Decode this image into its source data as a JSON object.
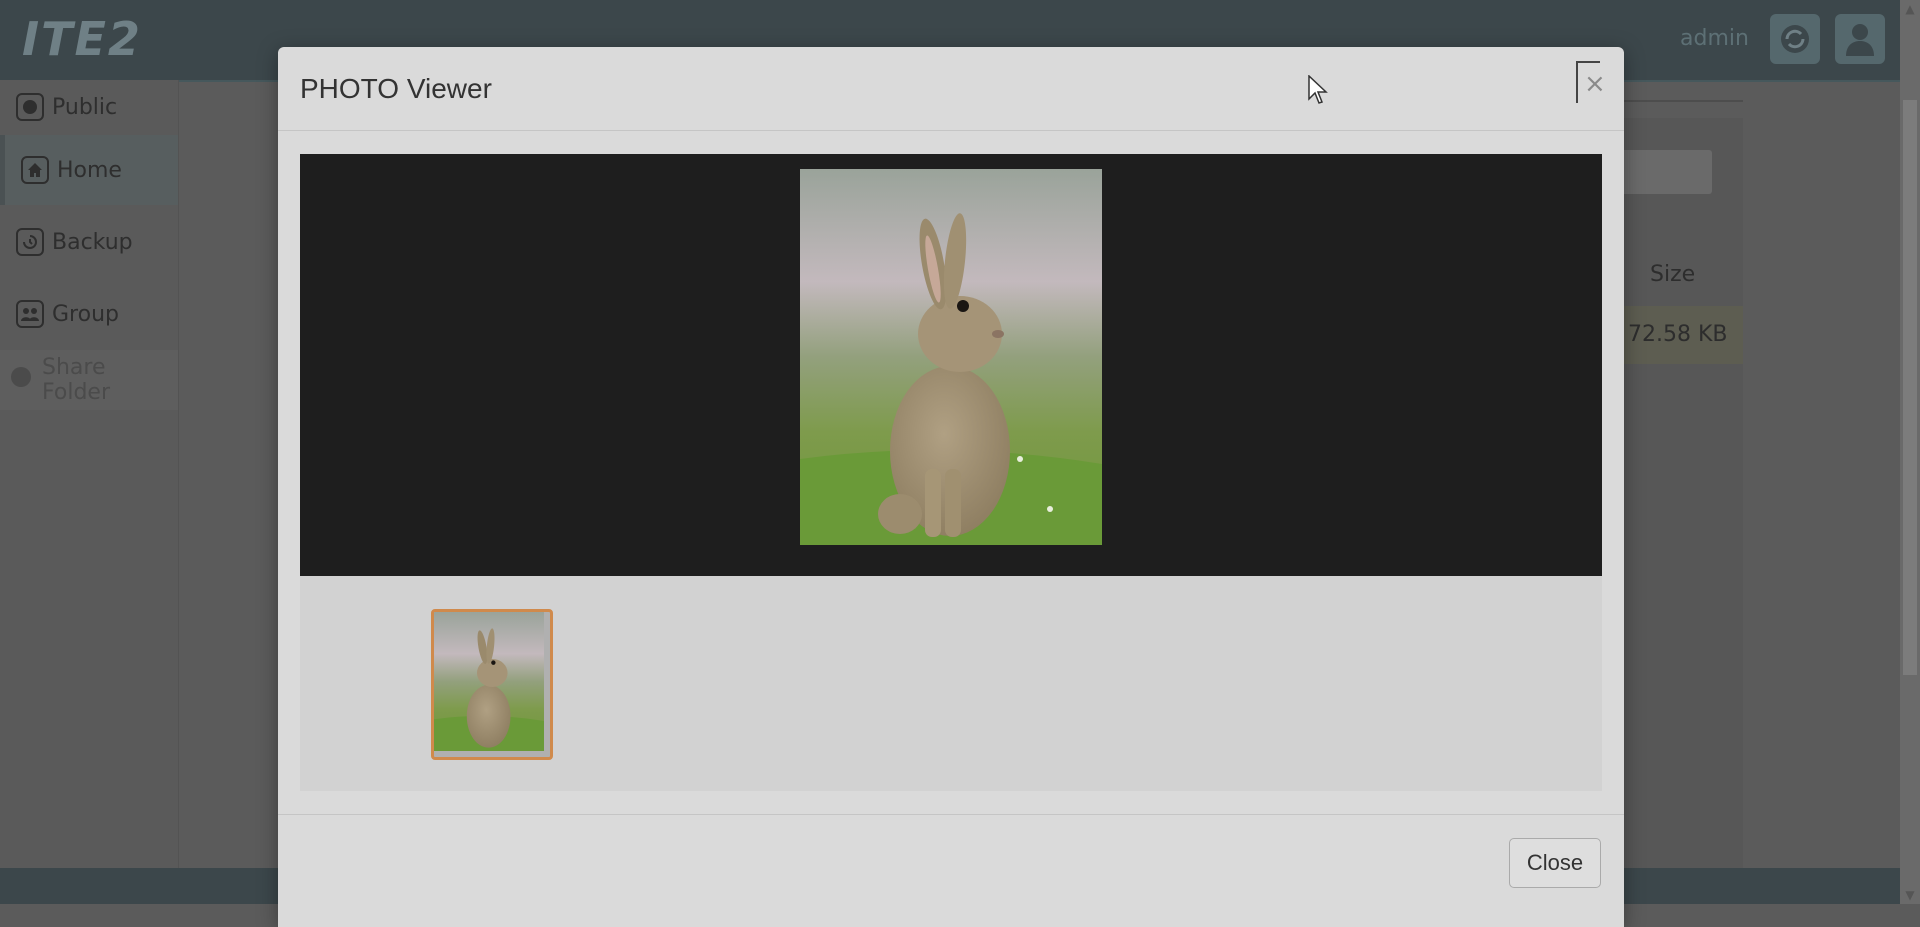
{
  "app": {
    "logo_text": "ITE2",
    "user_label": "admin"
  },
  "sidebar": {
    "items": [
      {
        "label": "Public",
        "icon": "globe-icon"
      },
      {
        "label": "Home",
        "icon": "home-icon"
      },
      {
        "label": "Backup",
        "icon": "backup-icon"
      },
      {
        "label": "Group",
        "icon": "group-icon"
      },
      {
        "label": "Share Folder",
        "icon": "share-icon"
      }
    ]
  },
  "file_table": {
    "size_header": "Size",
    "rows": [
      {
        "size": "72.58 KB"
      }
    ]
  },
  "modal": {
    "title": "PHOTO Viewer",
    "close_symbol": "×",
    "close_button_label": "Close",
    "thumbnail_selected_color": "#d08a4c"
  },
  "colors": {
    "topbar": "#3c474b",
    "viewer_background": "#1e1e1e",
    "modal_background": "#dadada"
  }
}
